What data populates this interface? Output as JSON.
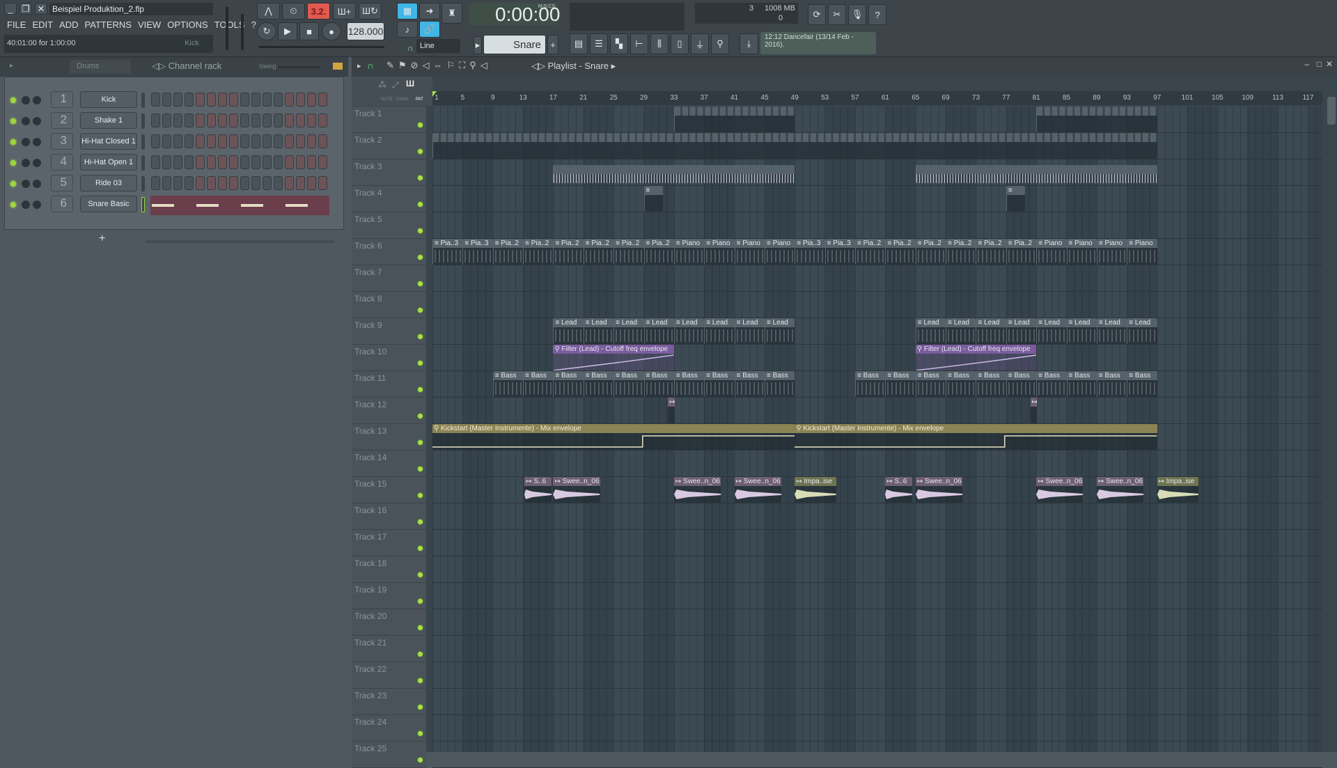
{
  "window": {
    "title": "Beispiel Produktion_2.flp",
    "hint": "40:01:00 for 1:00:00",
    "hint_channel": "Kick",
    "menus": [
      "FILE",
      "EDIT",
      "ADD",
      "PATTERNS",
      "VIEW",
      "OPTIONS",
      "TOOLS",
      "?"
    ]
  },
  "transport": {
    "pattern_song": "3.2.",
    "tempo": "128.000",
    "time": "0:00:00",
    "time_format": "M:S:CS",
    "pattern": "Snare",
    "snap": "Line",
    "cpu": "3",
    "memory": "1008 MB",
    "polyphony": "0",
    "news": "12:12  Dancefair (13/14 Feb - 2016)."
  },
  "channel_rack": {
    "group": "Drums",
    "title": "Channel rack",
    "swing_label": "Swing",
    "add": "+",
    "channels": [
      {
        "num": "1",
        "name": "Kick"
      },
      {
        "num": "2",
        "name": "Shake 1"
      },
      {
        "num": "3",
        "name": "Hi-Hat Closed 1"
      },
      {
        "num": "4",
        "name": "Hi-Hat Open 1"
      },
      {
        "num": "5",
        "name": "Ride 03"
      },
      {
        "num": "6",
        "name": "Snare Basic"
      }
    ]
  },
  "playlist": {
    "title": "Playlist - Snare",
    "modes": [
      "NOTE",
      "CHAN",
      "PAT"
    ],
    "ruler": [
      1,
      5,
      9,
      13,
      17,
      21,
      25,
      29,
      33,
      37,
      41,
      45,
      49,
      53,
      57,
      61,
      65,
      69,
      73,
      77,
      81,
      85,
      89,
      93,
      97,
      101,
      105,
      109,
      113,
      117
    ],
    "tracks": [
      "Track 1",
      "Track 2",
      "Track 3",
      "Track 4",
      "Track 5",
      "Track 6",
      "Track 7",
      "Track 8",
      "Track 9",
      "Track 10",
      "Track 11",
      "Track 12",
      "Track 13",
      "Track 14",
      "Track 15",
      "Track 16",
      "Track 17",
      "Track 18",
      "Track 19",
      "Track 20",
      "Track 21",
      "Track 22",
      "Track 23",
      "Track 24",
      "Track 25"
    ],
    "clips": [
      {
        "t": 1,
        "s": 33,
        "l": 16,
        "type": "pat",
        "label": "",
        "repeat": 1
      },
      {
        "t": 1,
        "s": 81,
        "l": 16,
        "type": "pat",
        "label": "",
        "repeat": 1
      },
      {
        "t": 2,
        "s": 1,
        "l": 96,
        "type": "pat",
        "label": "",
        "repeat": 1
      },
      {
        "t": 3,
        "s": 17,
        "l": 32,
        "type": "pat",
        "label": ""
      },
      {
        "t": 3,
        "s": 65,
        "l": 32,
        "type": "pat",
        "label": ""
      },
      {
        "t": 4,
        "s": 29,
        "l": 2.5,
        "type": "pat",
        "label": "≡"
      },
      {
        "t": 4,
        "s": 77,
        "l": 2.5,
        "type": "pat",
        "label": "≡"
      },
      {
        "t": 6,
        "s": 1,
        "l": 4,
        "type": "pat",
        "label": "≡ Pia..3"
      },
      {
        "t": 6,
        "s": 5,
        "l": 4,
        "type": "pat",
        "label": "≡ Pia..3"
      },
      {
        "t": 6,
        "s": 9,
        "l": 4,
        "type": "pat",
        "label": "≡ Pia..2"
      },
      {
        "t": 6,
        "s": 13,
        "l": 4,
        "type": "pat",
        "label": "≡ Pia..2"
      },
      {
        "t": 6,
        "s": 17,
        "l": 4,
        "type": "pat",
        "label": "≡ Pia..2"
      },
      {
        "t": 6,
        "s": 21,
        "l": 4,
        "type": "pat",
        "label": "≡ Pia..2"
      },
      {
        "t": 6,
        "s": 25,
        "l": 4,
        "type": "pat",
        "label": "≡ Pia..2"
      },
      {
        "t": 6,
        "s": 29,
        "l": 4,
        "type": "pat",
        "label": "≡ Pia..2"
      },
      {
        "t": 6,
        "s": 33,
        "l": 4,
        "type": "pat",
        "label": "≡ Piano"
      },
      {
        "t": 6,
        "s": 37,
        "l": 4,
        "type": "pat",
        "label": "≡ Piano"
      },
      {
        "t": 6,
        "s": 41,
        "l": 4,
        "type": "pat",
        "label": "≡ Piano"
      },
      {
        "t": 6,
        "s": 45,
        "l": 4,
        "type": "pat",
        "label": "≡ Piano"
      },
      {
        "t": 6,
        "s": 49,
        "l": 4,
        "type": "pat",
        "label": "≡ Pia..3"
      },
      {
        "t": 6,
        "s": 53,
        "l": 4,
        "type": "pat",
        "label": "≡ Pia..3"
      },
      {
        "t": 6,
        "s": 57,
        "l": 4,
        "type": "pat",
        "label": "≡ Pia..2"
      },
      {
        "t": 6,
        "s": 61,
        "l": 4,
        "type": "pat",
        "label": "≡ Pia..2"
      },
      {
        "t": 6,
        "s": 65,
        "l": 4,
        "type": "pat",
        "label": "≡ Pia..2"
      },
      {
        "t": 6,
        "s": 69,
        "l": 4,
        "type": "pat",
        "label": "≡ Pia..2"
      },
      {
        "t": 6,
        "s": 73,
        "l": 4,
        "type": "pat",
        "label": "≡ Pia..2"
      },
      {
        "t": 6,
        "s": 77,
        "l": 4,
        "type": "pat",
        "label": "≡ Pia..2"
      },
      {
        "t": 6,
        "s": 81,
        "l": 4,
        "type": "pat",
        "label": "≡ Piano"
      },
      {
        "t": 6,
        "s": 85,
        "l": 4,
        "type": "pat",
        "label": "≡ Piano"
      },
      {
        "t": 6,
        "s": 89,
        "l": 4,
        "type": "pat",
        "label": "≡ Piano"
      },
      {
        "t": 6,
        "s": 93,
        "l": 4,
        "type": "pat",
        "label": "≡ Piano"
      },
      {
        "t": 9,
        "s": 17,
        "l": 4,
        "type": "pat",
        "label": "≡ Lead"
      },
      {
        "t": 9,
        "s": 21,
        "l": 4,
        "type": "pat",
        "label": "≡ Lead"
      },
      {
        "t": 9,
        "s": 25,
        "l": 4,
        "type": "pat",
        "label": "≡ Lead"
      },
      {
        "t": 9,
        "s": 29,
        "l": 4,
        "type": "pat",
        "label": "≡ Lead"
      },
      {
        "t": 9,
        "s": 33,
        "l": 4,
        "type": "pat",
        "label": "≡ Lead"
      },
      {
        "t": 9,
        "s": 37,
        "l": 4,
        "type": "pat",
        "label": "≡ Lead"
      },
      {
        "t": 9,
        "s": 41,
        "l": 4,
        "type": "pat",
        "label": "≡ Lead"
      },
      {
        "t": 9,
        "s": 45,
        "l": 4,
        "type": "pat",
        "label": "≡ Lead"
      },
      {
        "t": 9,
        "s": 65,
        "l": 4,
        "type": "pat",
        "label": "≡ Lead"
      },
      {
        "t": 9,
        "s": 69,
        "l": 4,
        "type": "pat",
        "label": "≡ Lead"
      },
      {
        "t": 9,
        "s": 73,
        "l": 4,
        "type": "pat",
        "label": "≡ Lead"
      },
      {
        "t": 9,
        "s": 77,
        "l": 4,
        "type": "pat",
        "label": "≡ Lead"
      },
      {
        "t": 9,
        "s": 81,
        "l": 4,
        "type": "pat",
        "label": "≡ Lead"
      },
      {
        "t": 9,
        "s": 85,
        "l": 4,
        "type": "pat",
        "label": "≡ Lead"
      },
      {
        "t": 9,
        "s": 89,
        "l": 4,
        "type": "pat",
        "label": "≡ Lead"
      },
      {
        "t": 9,
        "s": 93,
        "l": 4,
        "type": "pat",
        "label": "≡ Lead"
      },
      {
        "t": 10,
        "s": 17,
        "l": 16,
        "type": "env-p",
        "label": "⚲ Filter (Lead) - Cutoff freq envelope"
      },
      {
        "t": 10,
        "s": 65,
        "l": 16,
        "type": "env-p",
        "label": "⚲ Filter (Lead) - Cutoff freq envelope"
      },
      {
        "t": 11,
        "s": 9,
        "l": 4,
        "type": "pat",
        "label": "≡ Bass"
      },
      {
        "t": 11,
        "s": 13,
        "l": 4,
        "type": "pat",
        "label": "≡ Bass"
      },
      {
        "t": 11,
        "s": 17,
        "l": 4,
        "type": "pat",
        "label": "≡ Bass"
      },
      {
        "t": 11,
        "s": 21,
        "l": 4,
        "type": "pat",
        "label": "≡ Bass"
      },
      {
        "t": 11,
        "s": 25,
        "l": 4,
        "type": "pat",
        "label": "≡ Bass"
      },
      {
        "t": 11,
        "s": 29,
        "l": 4,
        "type": "pat",
        "label": "≡ Bass"
      },
      {
        "t": 11,
        "s": 33,
        "l": 4,
        "type": "pat",
        "label": "≡ Bass"
      },
      {
        "t": 11,
        "s": 37,
        "l": 4,
        "type": "pat",
        "label": "≡ Bass"
      },
      {
        "t": 11,
        "s": 41,
        "l": 4,
        "type": "pat",
        "label": "≡ Bass"
      },
      {
        "t": 11,
        "s": 45,
        "l": 4,
        "type": "pat",
        "label": "≡ Bass"
      },
      {
        "t": 11,
        "s": 57,
        "l": 4,
        "type": "pat",
        "label": "≡ Bass"
      },
      {
        "t": 11,
        "s": 61,
        "l": 4,
        "type": "pat",
        "label": "≡ Bass"
      },
      {
        "t": 11,
        "s": 65,
        "l": 4,
        "type": "pat",
        "label": "≡ Bass"
      },
      {
        "t": 11,
        "s": 69,
        "l": 4,
        "type": "pat",
        "label": "≡ Bass"
      },
      {
        "t": 11,
        "s": 73,
        "l": 4,
        "type": "pat",
        "label": "≡ Bass"
      },
      {
        "t": 11,
        "s": 77,
        "l": 4,
        "type": "pat",
        "label": "≡ Bass"
      },
      {
        "t": 11,
        "s": 81,
        "l": 4,
        "type": "pat",
        "label": "≡ Bass"
      },
      {
        "t": 11,
        "s": 85,
        "l": 4,
        "type": "pat",
        "label": "≡ Bass"
      },
      {
        "t": 11,
        "s": 89,
        "l": 4,
        "type": "pat",
        "label": "≡ Bass"
      },
      {
        "t": 11,
        "s": 93,
        "l": 4,
        "type": "pat",
        "label": "≡ Bass"
      },
      {
        "t": 12,
        "s": 32.2,
        "l": 0.9,
        "type": "aud",
        "label": "↦"
      },
      {
        "t": 12,
        "s": 80.2,
        "l": 0.9,
        "type": "aud",
        "label": "↦"
      },
      {
        "t": 13,
        "s": 1,
        "l": 48,
        "type": "env-k",
        "label": "⚲ Kickstart (Master Instrumente) - Mix envelope"
      },
      {
        "t": 13,
        "s": 49,
        "l": 48,
        "type": "env-k",
        "label": "⚲ Kickstart (Master Instrumente) - Mix envelope"
      },
      {
        "t": 15,
        "s": 13.2,
        "l": 3.6,
        "type": "aud",
        "label": "↦ S..6"
      },
      {
        "t": 15,
        "s": 17,
        "l": 6.2,
        "type": "aud",
        "label": "↦ Swee..n_06"
      },
      {
        "t": 15,
        "s": 33,
        "l": 6.2,
        "type": "aud",
        "label": "↦ Swee..n_06"
      },
      {
        "t": 15,
        "s": 41,
        "l": 6.2,
        "type": "aud",
        "label": "↦ Swee..n_06"
      },
      {
        "t": 15,
        "s": 49,
        "l": 5.5,
        "type": "aud imp",
        "label": "↦ Impa..ise"
      },
      {
        "t": 15,
        "s": 61,
        "l": 3.6,
        "type": "aud",
        "label": "↦ S..6"
      },
      {
        "t": 15,
        "s": 65,
        "l": 6.2,
        "type": "aud",
        "label": "↦ Swee..n_06"
      },
      {
        "t": 15,
        "s": 81,
        "l": 6.2,
        "type": "aud",
        "label": "↦ Swee..n_06"
      },
      {
        "t": 15,
        "s": 89,
        "l": 6.2,
        "type": "aud",
        "label": "↦ Swee..n_06"
      },
      {
        "t": 15,
        "s": 97,
        "l": 5.5,
        "type": "aud imp",
        "label": "↦ Impa..ise"
      }
    ]
  },
  "colors": {
    "accent": "#9ed63b",
    "step_red": "#6c5357",
    "tempo_red": "#e05a50"
  }
}
